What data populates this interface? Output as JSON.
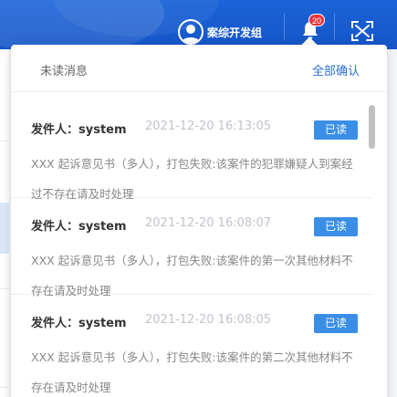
{
  "header": {
    "user_name": "案综开发组",
    "notification_count": "20",
    "colors": {
      "bar": "#1a63d8",
      "badge": "#e8343a"
    }
  },
  "popover": {
    "title": "未读消息",
    "confirm_all": "全部确认",
    "messages": [
      {
        "sender_label": "发件人：",
        "sender": "system",
        "time": "2021-12-20 16:13:05",
        "status": "已读",
        "content": "XXX 起诉意见书（多人），打包失败:该案件的犯罪嫌疑人到案经过不存在请及时处理"
      },
      {
        "sender_label": "发件人：",
        "sender": "system",
        "time": "2021-12-20 16:08:07",
        "status": "已读",
        "content": "XXX 起诉意见书（多人），打包失败:该案件的第一次其他材料不存在请及时处理"
      },
      {
        "sender_label": "发件人：",
        "sender": "system",
        "time": "2021-12-20 16:08:05",
        "status": "已读",
        "content": "XXX 起诉意见书（多人），打包失败:该案件的第二次其他材料不存在请及时处理"
      }
    ],
    "colors": {
      "link": "#2b6fd6",
      "status_button": "#3a8ee6"
    }
  }
}
